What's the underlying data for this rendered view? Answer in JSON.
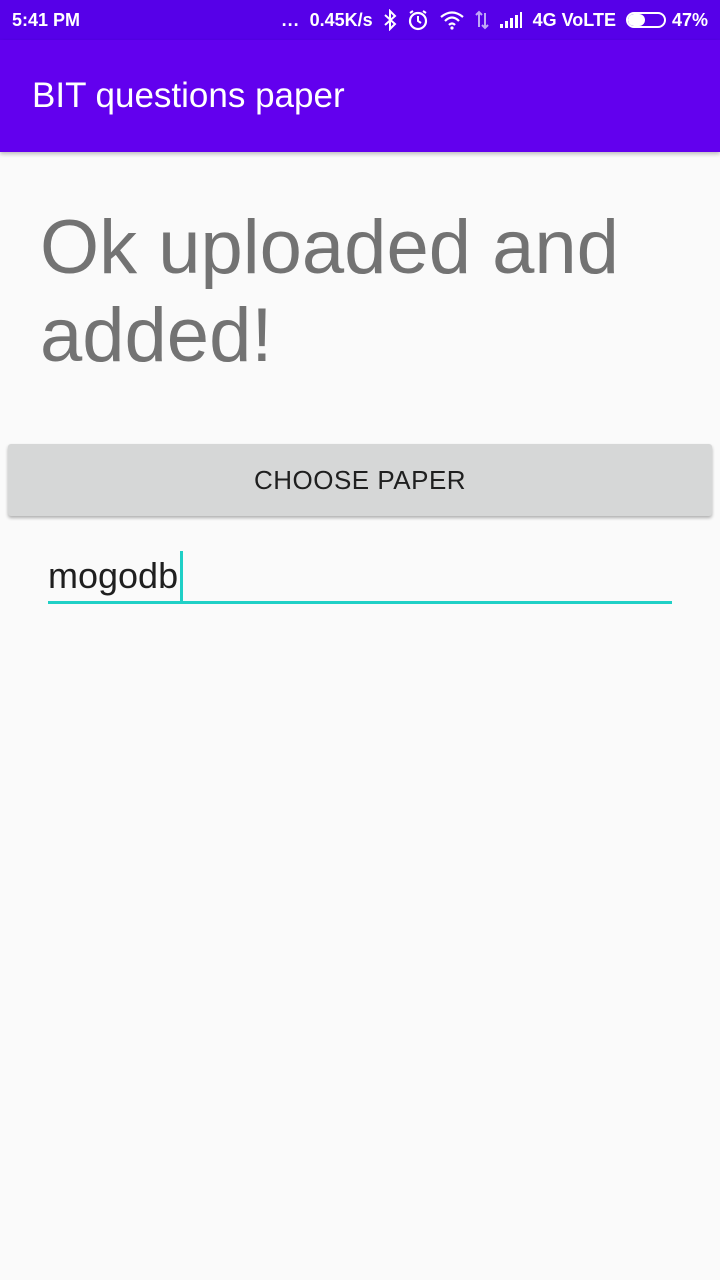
{
  "status_bar": {
    "time": "5:41 PM",
    "more_indicator": "...",
    "network_speed": "0.45K/s",
    "network_type": "4G VoLTE",
    "battery_percent": "47%",
    "battery_level": 0.47,
    "icons": [
      "bluetooth-icon",
      "alarm-icon",
      "wifi-icon",
      "data-arrows-icon",
      "signal-icon",
      "battery-icon"
    ]
  },
  "app_bar": {
    "title": "BIT questions paper",
    "color": "#6200ee"
  },
  "main": {
    "status_message": "Ok uploaded and added!",
    "choose_button_label": "CHOOSE PAPER",
    "paper_name_value": "mogodb",
    "accent_color": "#20d0c6"
  }
}
